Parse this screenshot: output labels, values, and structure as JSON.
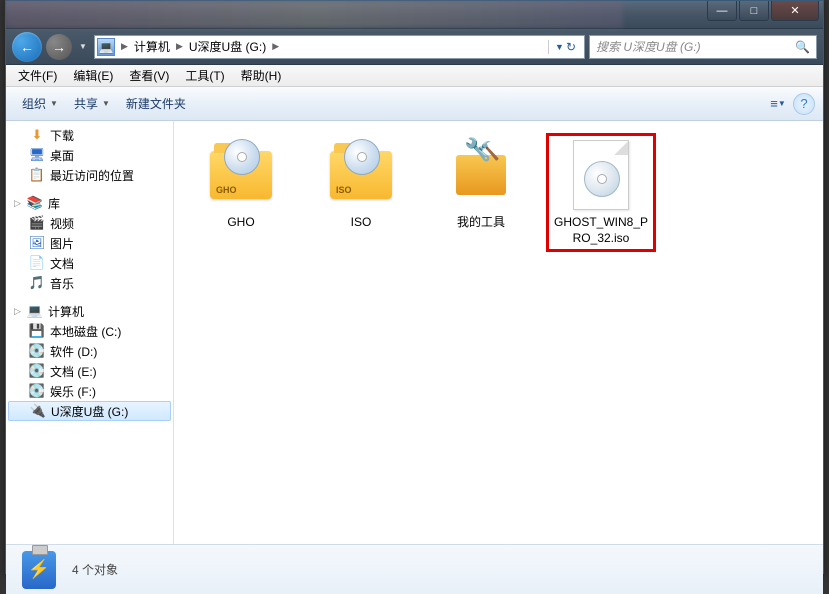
{
  "window_controls": {
    "min": "—",
    "max": "□",
    "close": "✕"
  },
  "address": {
    "segments": [
      "计算机",
      "U深度U盘 (G:)"
    ]
  },
  "search": {
    "placeholder": "搜索 U深度U盘 (G:)"
  },
  "menubar": [
    "文件(F)",
    "编辑(E)",
    "查看(V)",
    "工具(T)",
    "帮助(H)"
  ],
  "toolbar": {
    "organize": "组织",
    "share": "共享",
    "new_folder": "新建文件夹"
  },
  "sidebar": {
    "items": [
      {
        "type": "item",
        "icon": "⬇",
        "label": "下载",
        "color": "#e89830"
      },
      {
        "type": "item",
        "icon": "🖥",
        "label": "桌面",
        "color": "#2868c8"
      },
      {
        "type": "item",
        "icon": "📋",
        "label": "最近访问的位置",
        "color": "#777"
      },
      {
        "type": "group",
        "icon": "📚",
        "label": "库",
        "color": "#5a98d8"
      },
      {
        "type": "item",
        "icon": "🎬",
        "label": "视频",
        "color": "#2868c8"
      },
      {
        "type": "item",
        "icon": "🖼",
        "label": "图片",
        "color": "#2868c8"
      },
      {
        "type": "item",
        "icon": "📄",
        "label": "文档",
        "color": "#888"
      },
      {
        "type": "item",
        "icon": "🎵",
        "label": "音乐",
        "color": "#2888d8"
      },
      {
        "type": "group",
        "icon": "💻",
        "label": "计算机",
        "color": "#5a98d8"
      },
      {
        "type": "item",
        "icon": "💾",
        "label": "本地磁盘 (C:)",
        "color": "#5a98d8"
      },
      {
        "type": "item",
        "icon": "💽",
        "label": "软件 (D:)",
        "color": "#999"
      },
      {
        "type": "item",
        "icon": "💽",
        "label": "文档 (E:)",
        "color": "#999"
      },
      {
        "type": "item",
        "icon": "💽",
        "label": "娱乐 (F:)",
        "color": "#999"
      },
      {
        "type": "item",
        "icon": "🔌",
        "label": "U深度U盘 (G:)",
        "color": "#2868c8",
        "selected": true
      }
    ]
  },
  "files": [
    {
      "name": "GHO",
      "kind": "folder-disc",
      "tag": "GHO"
    },
    {
      "name": "ISO",
      "kind": "folder-disc",
      "tag": "ISO"
    },
    {
      "name": "我的工具",
      "kind": "toolbox"
    },
    {
      "name": "GHOST_WIN8_PRO_32.iso",
      "kind": "iso-file",
      "highlighted": true
    }
  ],
  "statusbar": {
    "count_label": "4 个对象"
  }
}
